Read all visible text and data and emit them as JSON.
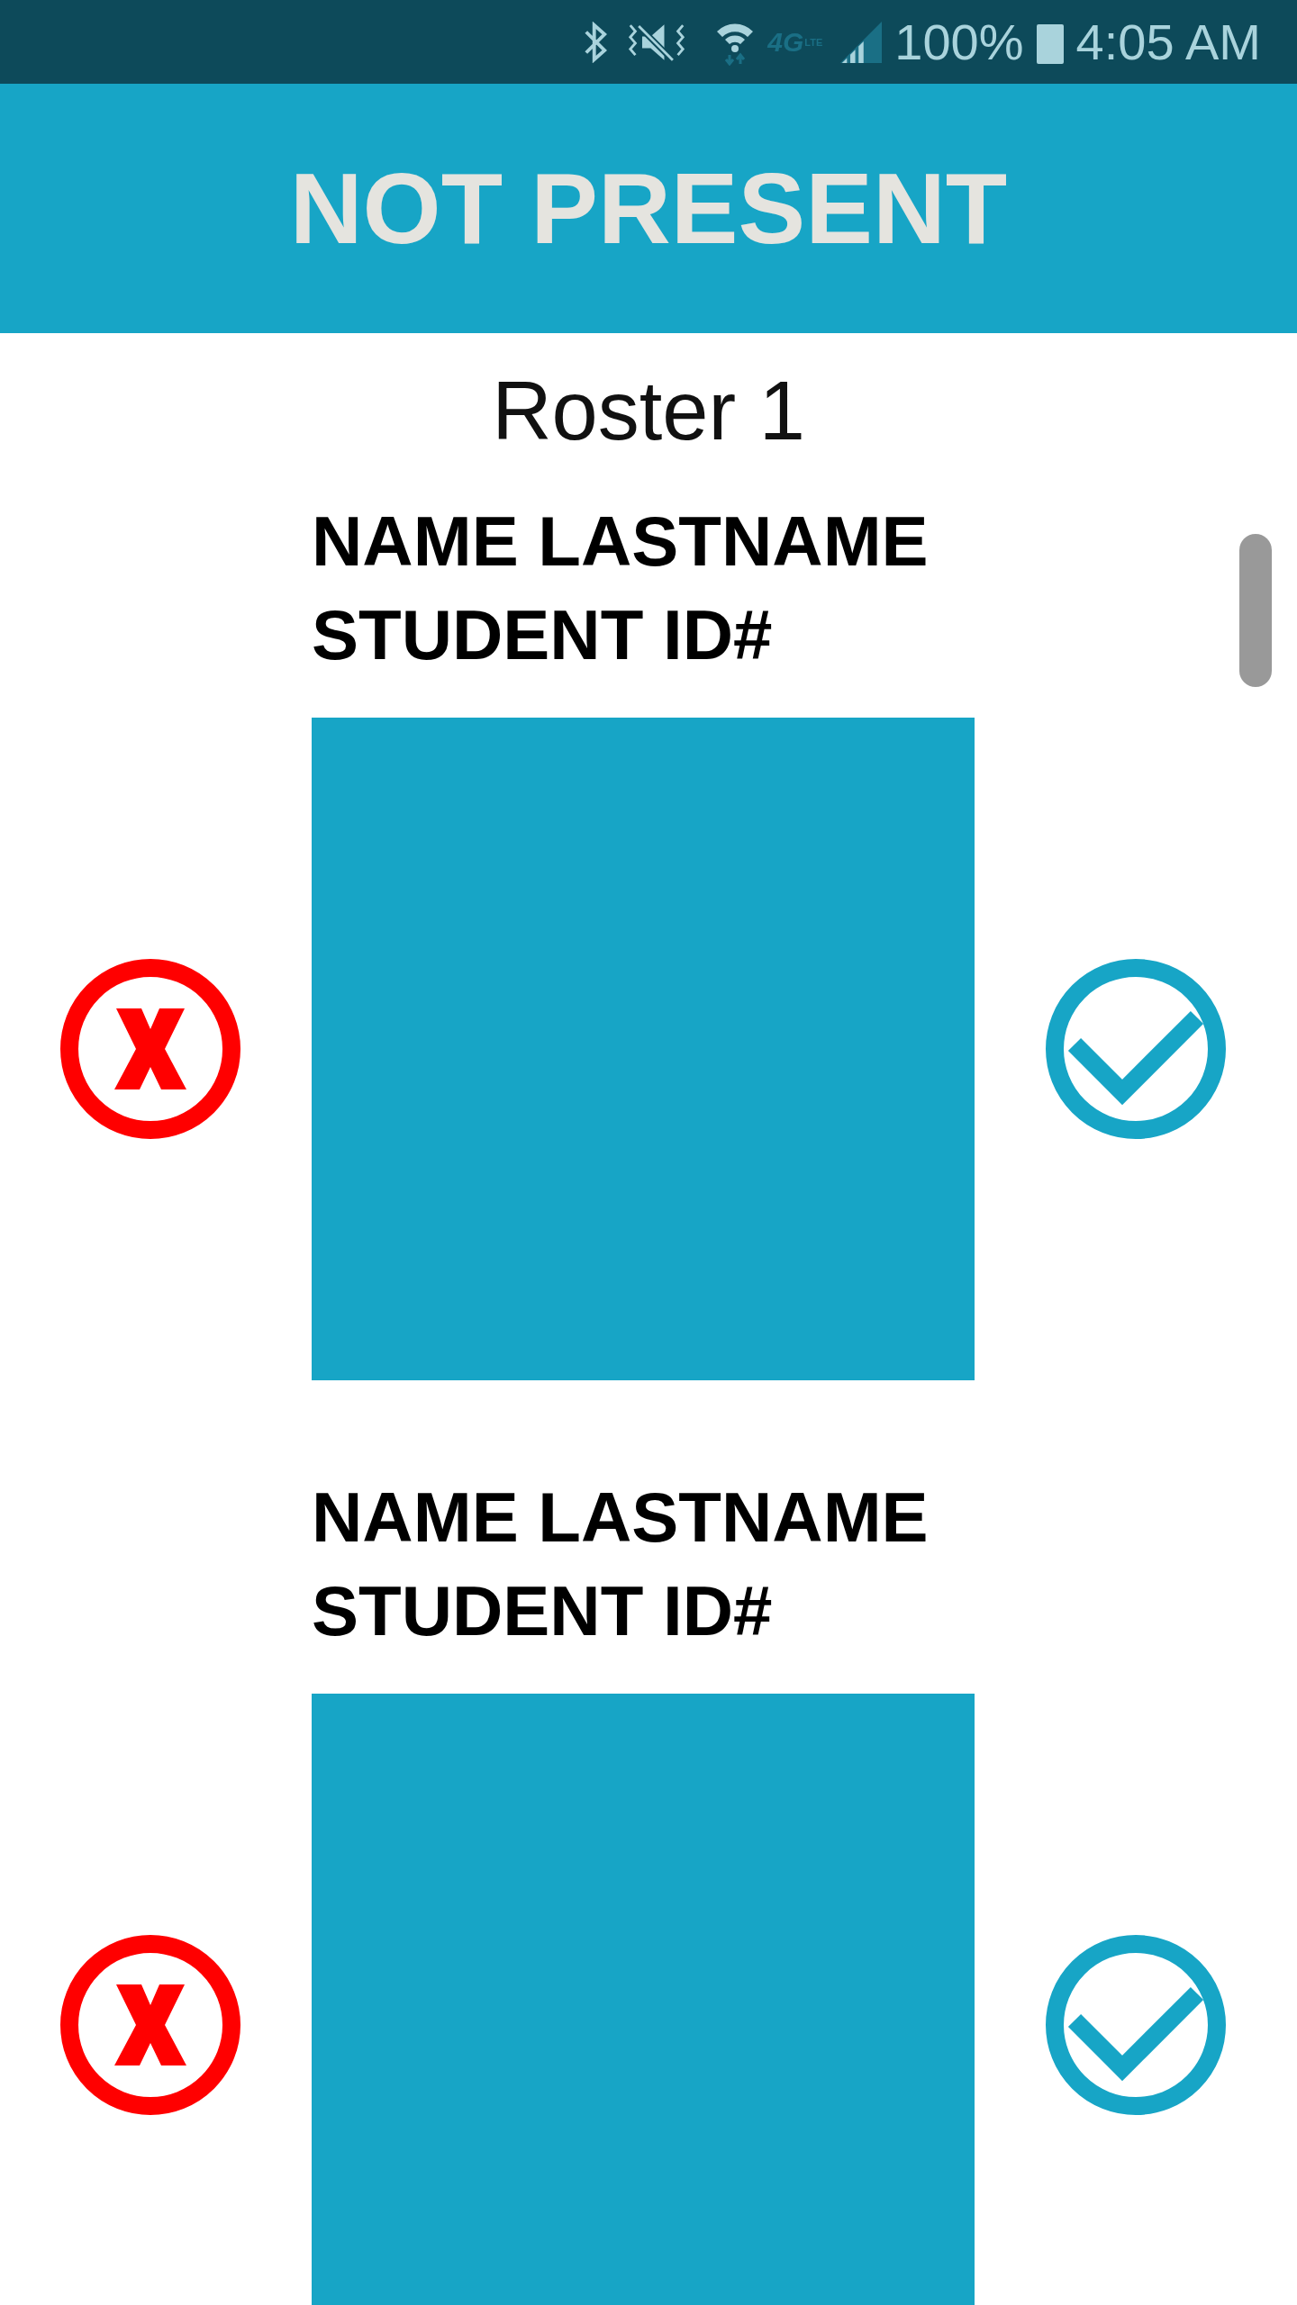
{
  "status_bar": {
    "network": "4G",
    "network_sub": "LTE",
    "battery": "100%",
    "time": "4:05 AM"
  },
  "header": {
    "title": "NOT PRESENT"
  },
  "roster_title": "Roster 1",
  "students": [
    {
      "name": "NAME LASTNAME",
      "id_label": "STUDENT ID#"
    },
    {
      "name": "NAME LASTNAME",
      "id_label": "STUDENT ID#"
    }
  ]
}
